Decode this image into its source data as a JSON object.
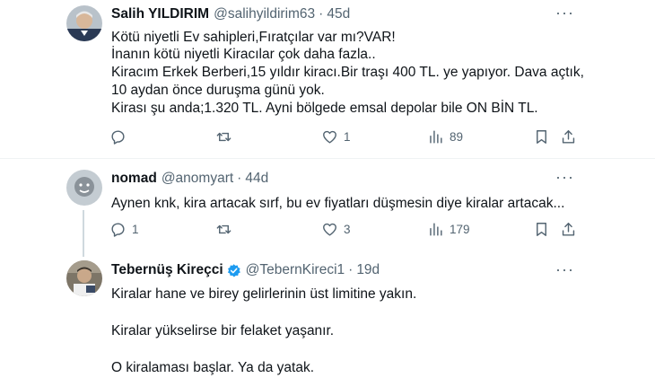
{
  "tweets": [
    {
      "name": "Salih YILDIRIM",
      "handle": "@salihyildirim63",
      "time": "45d",
      "verified": false,
      "lines": [
        "Kötü niyetli Ev sahipleri,Fıratçılar var mı?VAR!",
        "İnanın kötü niyetli Kiracılar çok daha fazla..",
        "Kiracım Erkek Berberi,15 yıldır kiracı.Bir traşı 400 TL. ye yapıyor. Dava açtık,",
        "10 aydan önce duruşma günü yok.",
        "Kirası şu anda;1.320 TL. Ayni bölgede emsal depolar bile ON BİN TL."
      ],
      "reply_count": "",
      "retweet_count": "",
      "like_count": "1",
      "view_count": "89"
    },
    {
      "name": "nomad",
      "handle": "@anomyart",
      "time": "44d",
      "verified": false,
      "lines": [
        "Aynen knk, kira artacak sırf, bu ev fiyatları düşmesin diye kiralar artacak..."
      ],
      "reply_count": "1",
      "retweet_count": "",
      "like_count": "3",
      "view_count": "179"
    },
    {
      "name": "Tebernüş Kireçci",
      "handle": "@TebernKireci1",
      "time": "19d",
      "verified": true,
      "lines": [
        "Kiralar hane ve birey gelirlerinin üst limitine yakın.",
        "",
        "Kiralar yükselirse bir felaket yaşanır.",
        "",
        "O kiralaması başlar. Ya da yatak."
      ]
    }
  ],
  "separator": "·",
  "more_label": "···",
  "colors": {
    "text": "#0f1419",
    "secondary": "#536471",
    "divider": "#eff3f4",
    "verified": "#1d9bf0"
  }
}
